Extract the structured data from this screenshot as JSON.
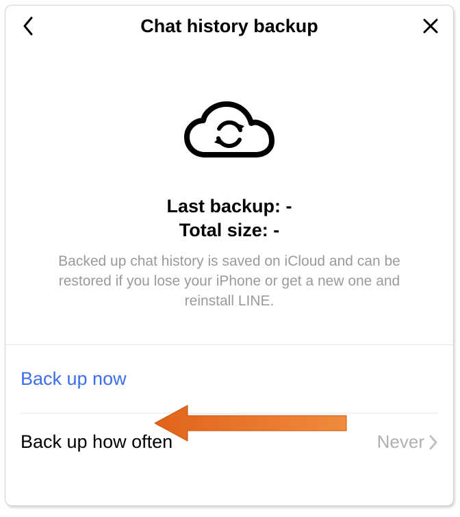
{
  "header": {
    "title": "Chat history backup"
  },
  "info": {
    "last_backup_label": "Last backup:",
    "last_backup_value": "-",
    "total_size_label": "Total size:",
    "total_size_value": "-",
    "description": "Backed up chat history is saved on iCloud and can be restored if you lose your iPhone or get a new one and reinstall LINE."
  },
  "actions": {
    "backup_now_label": "Back up now",
    "frequency_label": "Back up how often",
    "frequency_value": "Never"
  }
}
